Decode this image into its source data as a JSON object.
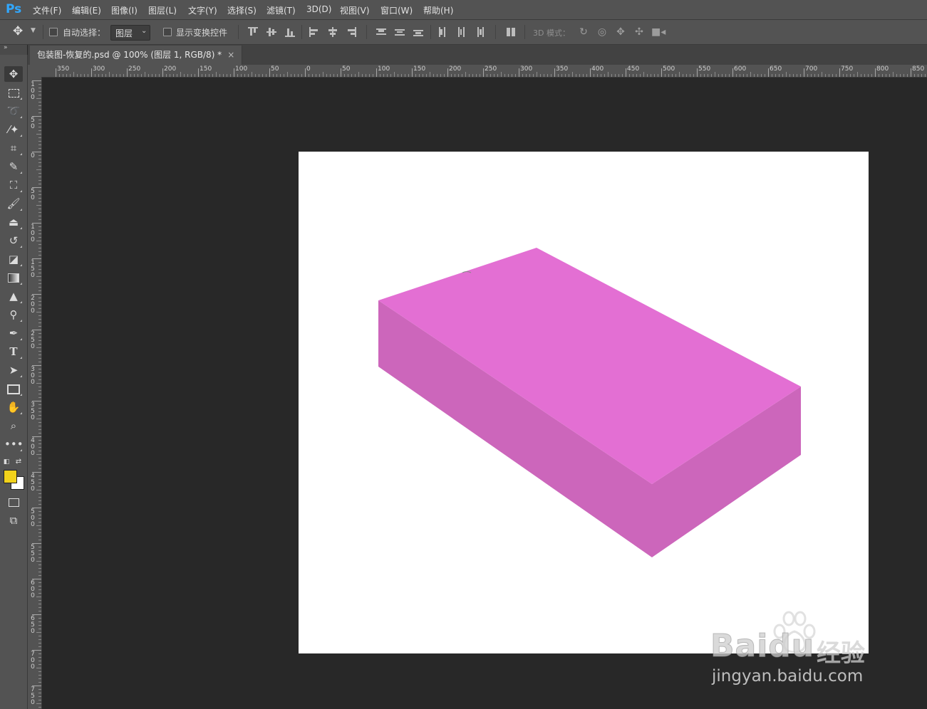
{
  "app": {
    "logo": "Ps",
    "menu": [
      "文件(F)",
      "编辑(E)",
      "图像(I)",
      "图层(L)",
      "文字(Y)",
      "选择(S)",
      "滤镜(T)",
      "3D(D)",
      "视图(V)",
      "窗口(W)",
      "帮助(H)"
    ]
  },
  "options": {
    "auto_select_label": "自动选择：",
    "auto_select_checked": false,
    "layer_select_value": "图层",
    "show_transform_label": "显示变换控件",
    "show_transform_checked": false,
    "mode_3d_label": "3D 模式："
  },
  "document": {
    "tab_title": "包装图-恢复的.psd @ 100% (图层 1, RGB/8) *",
    "close_glyph": "×"
  },
  "rulers": {
    "horizontal_labels": [
      "350",
      "300",
      "250",
      "200",
      "150",
      "100",
      "50",
      "0",
      "50",
      "100",
      "150",
      "200",
      "250",
      "300",
      "350",
      "400",
      "450",
      "500",
      "550",
      "600",
      "650",
      "700",
      "750",
      "800",
      "850"
    ],
    "vertical_labels": [
      "100",
      "50",
      "0",
      "50",
      "100",
      "150",
      "200",
      "250",
      "300",
      "350",
      "400",
      "450",
      "500",
      "550",
      "600",
      "650",
      "700",
      "750"
    ]
  },
  "tools": [
    {
      "name": "move-tool",
      "icon": "move-icon"
    },
    {
      "name": "marquee-tool",
      "icon": "marquee-icon"
    },
    {
      "name": "lasso-tool",
      "icon": "lasso-icon"
    },
    {
      "name": "magic-wand-tool",
      "icon": "magic-wand-icon"
    },
    {
      "name": "crop-tool",
      "icon": "crop-icon"
    },
    {
      "name": "eyedropper-tool",
      "icon": "eyedropper-icon"
    },
    {
      "name": "healing-tool",
      "icon": "healing-icon"
    },
    {
      "name": "brush-tool",
      "icon": "brush-icon"
    },
    {
      "name": "stamp-tool",
      "icon": "stamp-icon"
    },
    {
      "name": "history-brush-tool",
      "icon": "history-brush-icon"
    },
    {
      "name": "eraser-tool",
      "icon": "eraser-icon"
    },
    {
      "name": "gradient-tool",
      "icon": "gradient-icon"
    },
    {
      "name": "blur-tool",
      "icon": "blur-icon"
    },
    {
      "name": "dodge-tool",
      "icon": "dodge-icon"
    },
    {
      "name": "pen-tool",
      "icon": "pen-icon"
    },
    {
      "name": "type-tool",
      "icon": "type-icon"
    },
    {
      "name": "path-select-tool",
      "icon": "arrow-icon"
    },
    {
      "name": "rectangle-tool",
      "icon": "rectangle-icon"
    },
    {
      "name": "hand-tool",
      "icon": "hand-icon"
    },
    {
      "name": "zoom-tool",
      "icon": "zoom-icon"
    },
    {
      "name": "more-tools",
      "icon": "more-icon"
    }
  ],
  "colors": {
    "foreground": "#f2d21b",
    "background": "#ffffff",
    "box_top": "#e36fd3",
    "box_left": "#cc66bb",
    "box_right": "#cc66bb"
  },
  "watermark": {
    "brand": "Baidu",
    "brand_cn": "经验",
    "url": "jingyan.baidu.com"
  }
}
